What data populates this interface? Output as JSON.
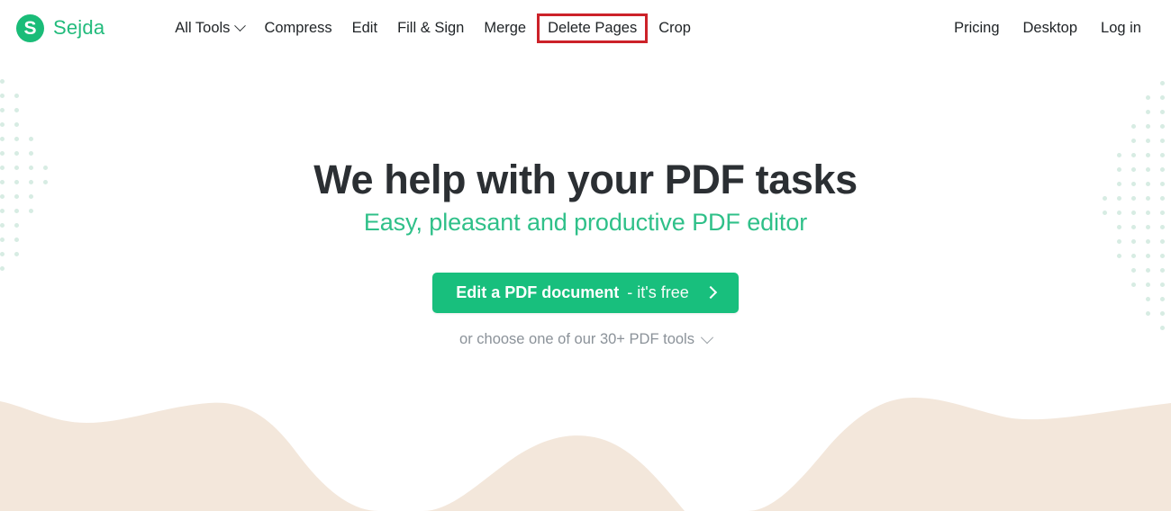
{
  "brand": {
    "mark_letter": "S",
    "name": "Sejda",
    "color": "#22bb7c"
  },
  "nav": {
    "main": [
      {
        "label": "All Tools",
        "has_caret": true,
        "highlighted": false
      },
      {
        "label": "Compress",
        "has_caret": false,
        "highlighted": false
      },
      {
        "label": "Edit",
        "has_caret": false,
        "highlighted": false
      },
      {
        "label": "Fill & Sign",
        "has_caret": false,
        "highlighted": false
      },
      {
        "label": "Merge",
        "has_caret": false,
        "highlighted": false
      },
      {
        "label": "Delete Pages",
        "has_caret": false,
        "highlighted": true
      },
      {
        "label": "Crop",
        "has_caret": false,
        "highlighted": false
      }
    ],
    "right": [
      {
        "label": "Pricing"
      },
      {
        "label": "Desktop"
      },
      {
        "label": "Log in"
      }
    ],
    "highlight_color": "#cc2229"
  },
  "hero": {
    "title": "We help with your PDF tasks",
    "subtitle": "Easy, pleasant and productive PDF editor",
    "subtitle_color": "#2fc089",
    "cta": {
      "strong_label": "Edit a PDF document",
      "light_label": "- it's free",
      "arrow_icon": "chevron-right-icon",
      "background": "#18bf7d"
    },
    "sub_cta": {
      "label": "or choose one of our 30+ PDF tools",
      "caret_icon": "chevron-down-icon"
    }
  },
  "decor": {
    "dot_color": "#d7ece3",
    "wave_color": "#f3e7db"
  }
}
